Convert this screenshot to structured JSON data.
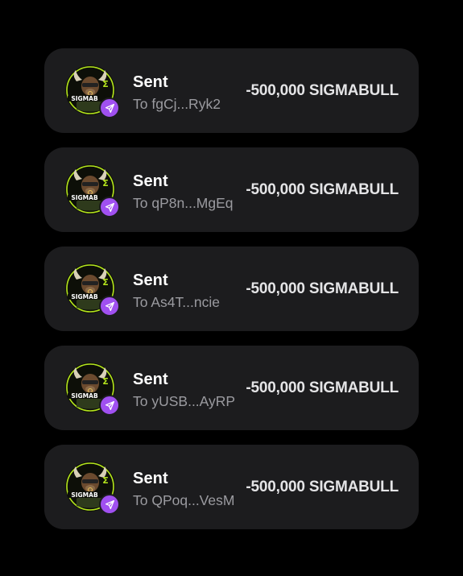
{
  "transactions": [
    {
      "title": "Sent",
      "subtitle": "To fgCj...Ryk2",
      "amount": "-500,000 SIGMABULL",
      "avatar_icon": "sigmabull-logo-icon",
      "badge_icon": "send-arrow-icon"
    },
    {
      "title": "Sent",
      "subtitle": "To qP8n...MgEq",
      "amount": "-500,000 SIGMABULL",
      "avatar_icon": "sigmabull-logo-icon",
      "badge_icon": "send-arrow-icon"
    },
    {
      "title": "Sent",
      "subtitle": "To As4T...ncie",
      "amount": "-500,000 SIGMABULL",
      "avatar_icon": "sigmabull-logo-icon",
      "badge_icon": "send-arrow-icon"
    },
    {
      "title": "Sent",
      "subtitle": "To yUSB...AyRP",
      "amount": "-500,000 SIGMABULL",
      "avatar_icon": "sigmabull-logo-icon",
      "badge_icon": "send-arrow-icon"
    },
    {
      "title": "Sent",
      "subtitle": "To QPoq...VesM",
      "amount": "-500,000 SIGMABULL",
      "avatar_icon": "sigmabull-logo-icon",
      "badge_icon": "send-arrow-icon"
    }
  ],
  "colors": {
    "background": "#000000",
    "card": "#1c1c1e",
    "badge": "#a050f0",
    "logo_accent": "#b5e61d"
  }
}
